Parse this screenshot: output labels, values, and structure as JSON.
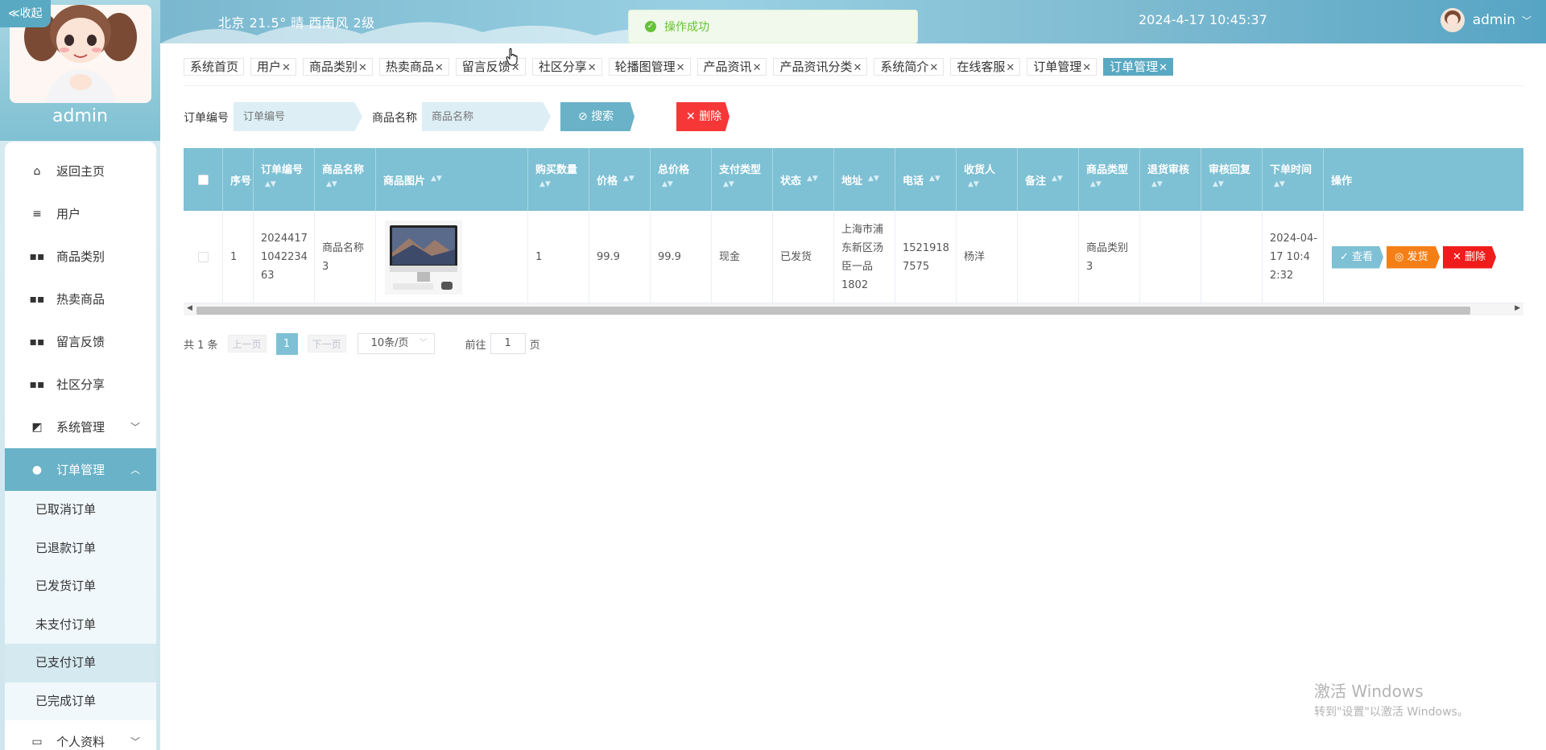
{
  "sidebar": {
    "collapse_label": "≪收起",
    "admin_name": "admin",
    "items": [
      {
        "label": "返回主页",
        "icon": "home-icon"
      },
      {
        "label": "用户",
        "icon": "list-icon"
      },
      {
        "label": "商品类别",
        "icon": "grid-icon"
      },
      {
        "label": "热卖商品",
        "icon": "grid-icon"
      },
      {
        "label": "留言反馈",
        "icon": "grid-icon"
      },
      {
        "label": "社区分享",
        "icon": "grid-icon"
      },
      {
        "label": "系统管理",
        "icon": "chart-icon"
      },
      {
        "label": "订单管理",
        "icon": "user-icon"
      }
    ],
    "order_submenu": [
      "已取消订单",
      "已退款订单",
      "已发货订单",
      "未支付订单",
      "已支付订单",
      "已完成订单"
    ],
    "profile_label": "个人资料"
  },
  "header": {
    "weather": "北京  21.5°  晴  西南风  2级",
    "datetime": "2024-4-17 10:45:37",
    "user": "admin"
  },
  "toast": {
    "message": "操作成功"
  },
  "tags": [
    "系统首页",
    "用户",
    "商品类别",
    "热卖商品",
    "留言反馈",
    "社区分享",
    "轮播图管理",
    "产品资讯",
    "产品资讯分类",
    "系统简介",
    "在线客服",
    "订单管理",
    "订单管理"
  ],
  "search": {
    "order_no_label": "订单编号",
    "order_no_placeholder": "订单编号",
    "product_label": "商品名称",
    "product_placeholder": "商品名称",
    "search_button": "搜索",
    "delete_button": "删除"
  },
  "table": {
    "columns": [
      "序号",
      "订单编号",
      "商品名称",
      "商品图片",
      "购买数量",
      "价格",
      "总价格",
      "支付类型",
      "状态",
      "地址",
      "电话",
      "收货人",
      "备注",
      "商品类型",
      "退货审核",
      "审核回复",
      "下单时间",
      "操作"
    ],
    "rows": [
      {
        "index": "1",
        "order_no": "20244171042234 63",
        "product_name": "商品名称3",
        "quantity": "1",
        "price": "99.9",
        "total": "99.9",
        "pay_type": "现金",
        "status": "已发货",
        "address": "上海市浦东新区汤臣一品1802",
        "phone": "15219187575",
        "receiver": "杨洋",
        "remark": "",
        "product_type": "商品类别3",
        "return_review": "",
        "review_reply": "",
        "order_time": "2024-04-17 10:42:32"
      }
    ],
    "row_actions": {
      "view": "查看",
      "ship": "发货",
      "delete": "删除"
    }
  },
  "pager": {
    "total": "共 1 条",
    "prev": "上一页",
    "current": "1",
    "next": "下一页",
    "page_size": "10条/页",
    "jump_prefix": "前往",
    "jump_value": "1",
    "jump_suffix": "页"
  },
  "watermark": {
    "line1": "激活 Windows",
    "line2": "转到\"设置\"以激活 Windows。"
  }
}
